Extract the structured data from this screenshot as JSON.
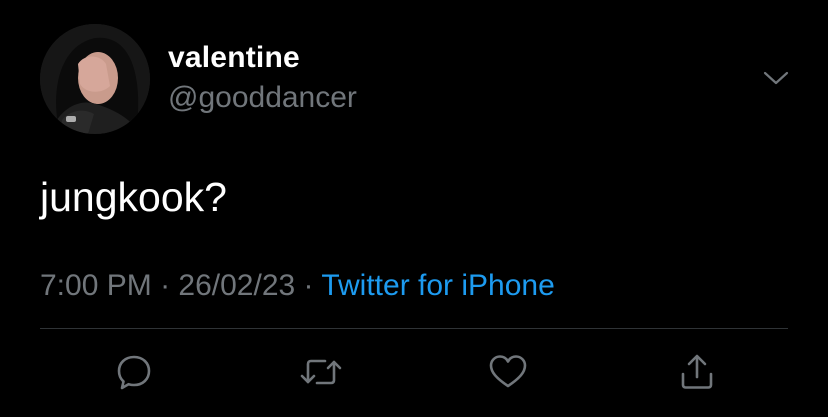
{
  "tweet": {
    "display_name": "valentine",
    "handle": "@gooddancer",
    "text": "jungkook?",
    "time": "7:00 PM",
    "separator": "·",
    "date": "26/02/23",
    "source": "Twitter for iPhone"
  },
  "icons": {
    "caret": "chevron-down-icon",
    "reply": "reply-icon",
    "retweet": "retweet-icon",
    "like": "heart-icon",
    "share": "share-icon"
  },
  "colors": {
    "background": "#000000",
    "text_primary": "#ffffff",
    "text_muted": "#71767b",
    "accent": "#1d9bf0",
    "divider": "#2f3336"
  }
}
